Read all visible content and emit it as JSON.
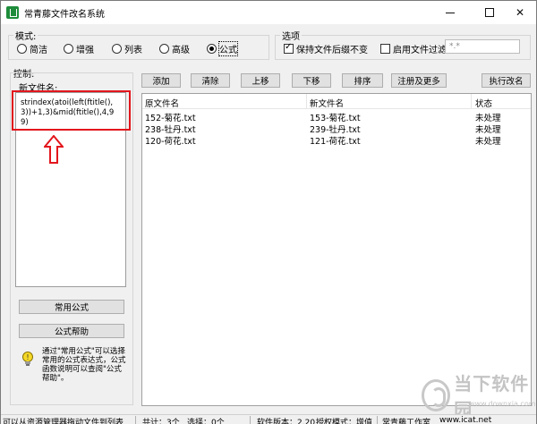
{
  "window": {
    "title": "常青藤文件改名系统",
    "accent": "#1e8c3a"
  },
  "mode": {
    "label": "模式:",
    "options": [
      "简洁",
      "增强",
      "列表",
      "高级",
      "公式"
    ],
    "selected": "公式"
  },
  "options": {
    "label": "选项",
    "keep_ext": "保持文件后缀不变",
    "keep_ext_checked": true,
    "enable_filter": "启用文件过滤",
    "enable_filter_checked": false,
    "filter_value": "*.*"
  },
  "control": {
    "label": "控制:",
    "new_name_label": "新文件名:",
    "formula": "strindex(atoi(left(ftitle(),3))+1,3)&mid(ftitle(),4,99)",
    "common_formula_button": "常用公式",
    "formula_help_button": "公式帮助",
    "tip": "通过\"常用公式\"可以选择常用的公式表达式，公式函数说明可以查阅\"公式帮助\"。"
  },
  "toolbar": {
    "add": "添加",
    "clear": "清除",
    "move_up": "上移",
    "move_down": "下移",
    "sort": "排序",
    "register": "注册及更多",
    "execute": "执行改名"
  },
  "list": {
    "columns": [
      "原文件名",
      "新文件名",
      "状态"
    ],
    "rows": [
      [
        "152-菊花.txt",
        "153-菊花.txt",
        "未处理"
      ],
      [
        "238-牡丹.txt",
        "239-牡丹.txt",
        "未处理"
      ],
      [
        "120-荷花.txt",
        "121-荷花.txt",
        "未处理"
      ]
    ]
  },
  "watermark": {
    "name": "当下软件园",
    "url": "www.downxia.com"
  },
  "status": {
    "hint": "可以从资源管理器拖动文件到列表",
    "total": "共计：3个",
    "selected": "选择：0个",
    "version": "软件版本：2.20",
    "auth": "授权模式：增值",
    "studio": "常青藤工作室",
    "site": "www.icat.net"
  }
}
